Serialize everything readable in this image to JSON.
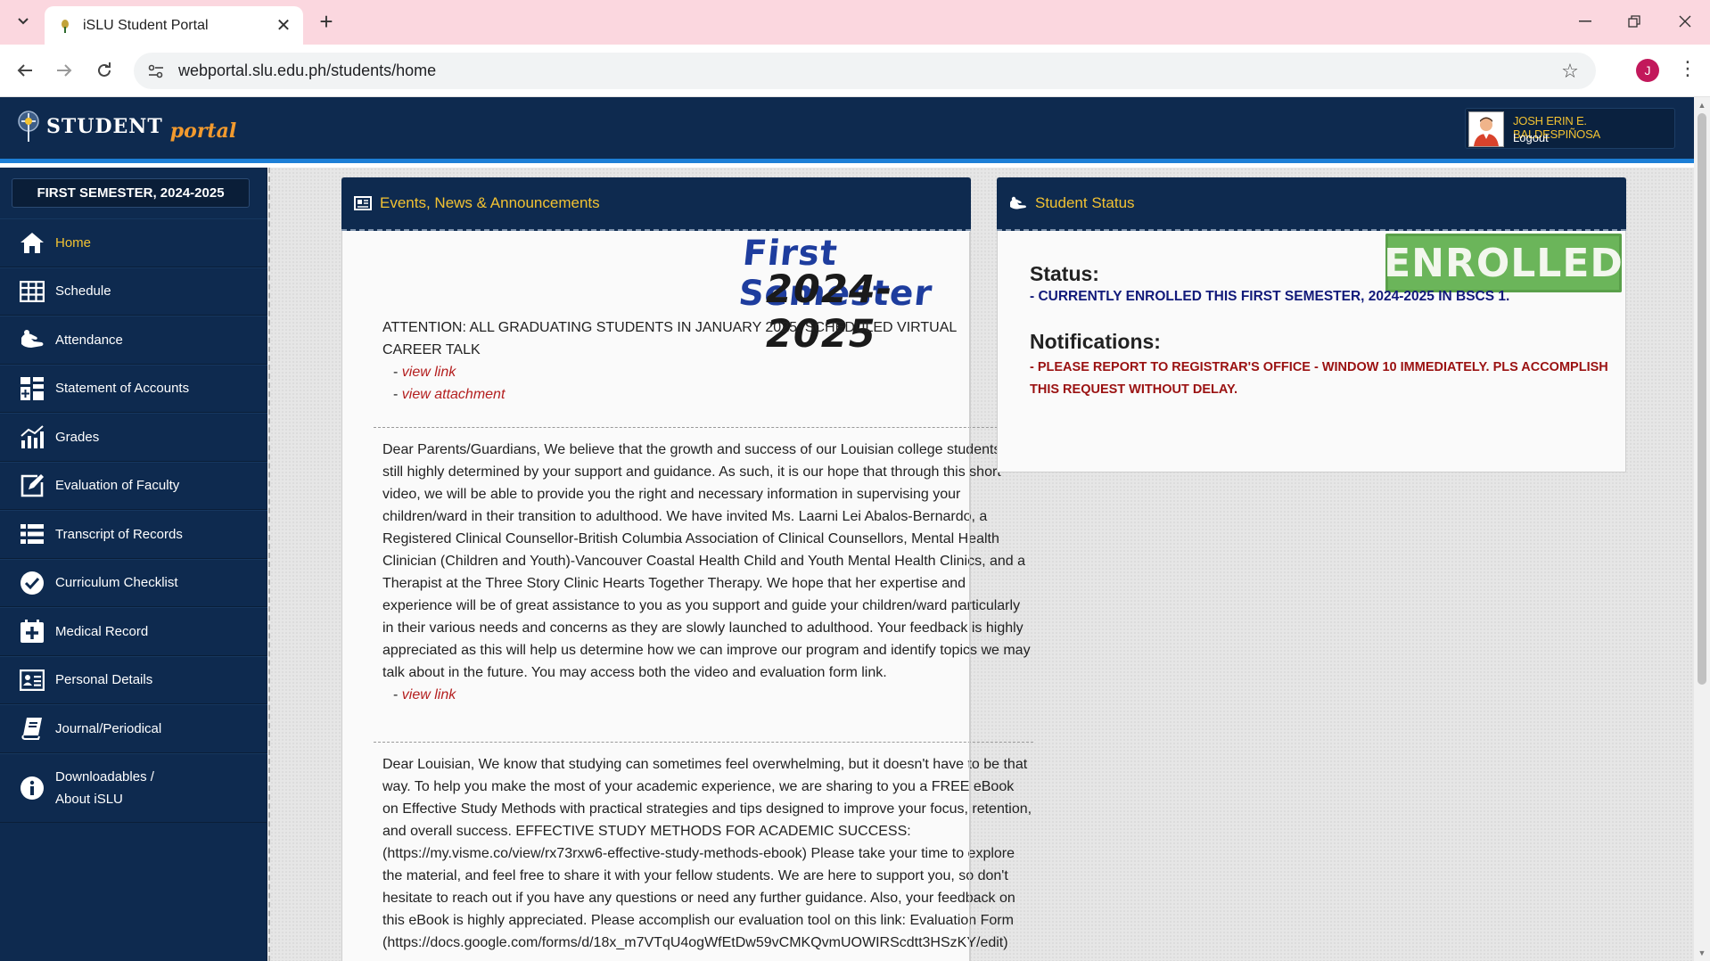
{
  "browser": {
    "tab_title": "iSLU Student Portal",
    "url": "webportal.slu.edu.ph/students/home",
    "profile_initial": "J"
  },
  "portal": {
    "logo_word1": "STUDENT",
    "logo_word2": "portal",
    "user_name": "JOSH ERIN E. BALDESPIÑOSA",
    "logout_label": "Logout"
  },
  "sidebar": {
    "semester": "FIRST SEMESTER, 2024-2025",
    "items": [
      {
        "label": "Home",
        "icon": "home-icon"
      },
      {
        "label": "Schedule",
        "icon": "schedule-table-icon"
      },
      {
        "label": "Attendance",
        "icon": "attendance-hand-icon"
      },
      {
        "label": "Statement of Accounts",
        "icon": "statement-grid-icon"
      },
      {
        "label": "Grades",
        "icon": "grades-chart-icon"
      },
      {
        "label": "Evaluation of Faculty",
        "icon": "edit-icon"
      },
      {
        "label": "Transcript of Records",
        "icon": "list-icon"
      },
      {
        "label": "Curriculum Checklist",
        "icon": "check-circle-icon"
      },
      {
        "label": "Medical Record",
        "icon": "medical-icon"
      },
      {
        "label": "Personal Details",
        "icon": "id-card-icon"
      },
      {
        "label": "Journal/Periodical",
        "icon": "book-icon"
      },
      {
        "label_line1": "Downloadables /",
        "label_line2": "About iSLU",
        "icon": "info-icon"
      }
    ]
  },
  "events": {
    "title": "Events, News & Announcements",
    "banner_line1": "First Semester",
    "banner_line2": "2024-2025",
    "announcements": [
      {
        "text": "ATTENTION: ALL GRADUATING STUDENTS IN JANUARY 2025. SCHEDULED VIRTUAL CAREER TALK",
        "links": [
          "view link",
          "view attachment"
        ]
      },
      {
        "text": "Dear Parents/Guardians, We believe that the growth and success of our Louisian college students are still highly determined by your support and guidance. As such, it is our hope that through this short video, we will be able to provide you the right and necessary information in supervising your children/ward in their transition to adulthood. We have invited Ms. Laarni Lei Abalos-Bernardo, a Registered Clinical Counsellor-British Columbia Association of Clinical Counsellors, Mental Health Clinician (Children and Youth)-Vancouver Coastal Health Child and Youth Mental Health Clinics, and a Therapist at the Three Story Clinic Hearts Together Therapy. We hope that her expertise and experience will be of great assistance to you as you support and guide your children/ward particularly in their various needs and concerns as they are slowly launched to adulthood. Your feedback is highly appreciated as this will help us determine how we can improve our program and identify topics we may talk about in the future. You may access both the video and evaluation form link.",
        "links": [
          "view link"
        ]
      },
      {
        "text": "Dear Louisian, We know that studying can sometimes feel overwhelming, but it doesn't have to be that way. To help you make the most of your academic experience, we are sharing to you a FREE eBook on Effective Study Methods with practical strategies and tips designed to improve your focus, retention, and overall success. EFFECTIVE STUDY METHODS FOR ACADEMIC SUCCESS: (https://my.visme.co/view/rx73rxw6-effective-study-methods-ebook) Please take your time to explore the material, and feel free to share it with your fellow students. We are here to support you, so don't hesitate to reach out if you have any questions or need any further guidance. Also, your feedback on this eBook is highly appreciated. Please accomplish our evaluation tool on this link: Evaluation Form (https://docs.google.com/forms/d/18x_m7VTqU4ogWfEtDw59vCMKQvmUOWIRScdtt3HSzKY/edit)",
        "links": []
      }
    ]
  },
  "status": {
    "title": "Student Status",
    "stamp": "ENROLLED",
    "status_heading": "Status:",
    "status_text": "CURRENTLY ENROLLED THIS FIRST SEMESTER, 2024-2025 IN BSCS 1.",
    "notifications_heading": "Notifications:",
    "notification_text": "PLEASE REPORT TO REGISTRAR'S OFFICE - WINDOW 10 IMMEDIATELY. PLS ACCOMPLISH THIS REQUEST WITHOUT DELAY."
  },
  "colors": {
    "navy": "#0e2a4f",
    "gold": "#f2c232",
    "link_red": "#b41f1f",
    "status_blue": "#121a7a",
    "notice_red": "#9a1111",
    "enrolled_green": "#6bb55a"
  }
}
